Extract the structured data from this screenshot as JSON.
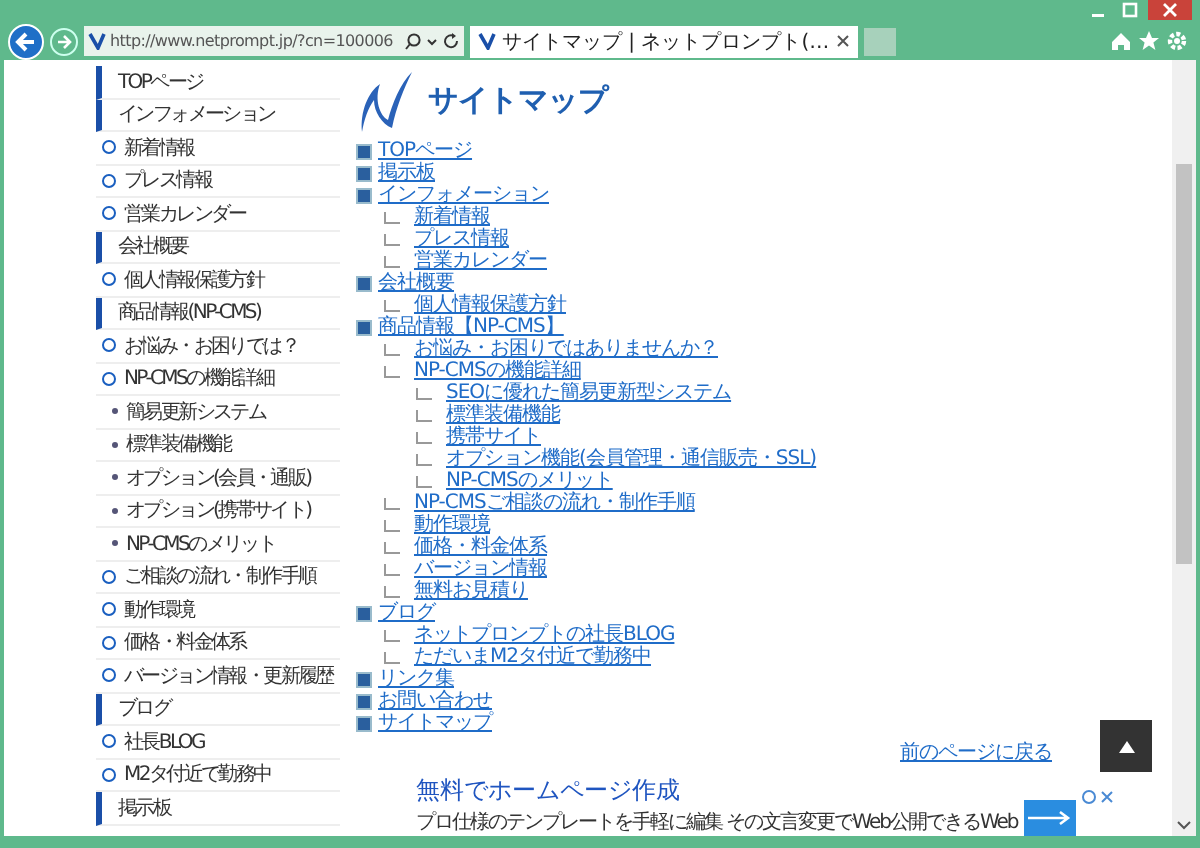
{
  "browser": {
    "address": "http://www.netprompt.jp/?cn=100006",
    "tab_title": "サイトマップ | ネットプロンプト(…"
  },
  "sidebar": {
    "items": [
      {
        "label": "TOPページ",
        "kind": "header"
      },
      {
        "label": "インフォメーション",
        "kind": "header"
      },
      {
        "label": "新着情報",
        "kind": "circle"
      },
      {
        "label": "プレス情報",
        "kind": "circle"
      },
      {
        "label": "営業カレンダー",
        "kind": "circle"
      },
      {
        "label": "会社概要",
        "kind": "header"
      },
      {
        "label": "個人情報保護方針",
        "kind": "circle"
      },
      {
        "label": "商品情報(NP-CMS)",
        "kind": "header"
      },
      {
        "label": "お悩み・お困りでは？",
        "kind": "circle"
      },
      {
        "label": "NP-CMSの機能詳細",
        "kind": "circle"
      },
      {
        "label": "簡易更新システム",
        "kind": "dot"
      },
      {
        "label": "標準装備機能",
        "kind": "dot"
      },
      {
        "label": "オプション(会員・通販)",
        "kind": "dot"
      },
      {
        "label": "オプション(携帯サイト)",
        "kind": "dot"
      },
      {
        "label": "NP-CMSのメリット",
        "kind": "dot"
      },
      {
        "label": "ご相談の流れ・制作手順",
        "kind": "circle"
      },
      {
        "label": "動作環境",
        "kind": "circle"
      },
      {
        "label": "価格・料金体系",
        "kind": "circle"
      },
      {
        "label": "バージョン情報・更新履歴",
        "kind": "circle"
      },
      {
        "label": "ブログ",
        "kind": "header"
      },
      {
        "label": "社長BLOG",
        "kind": "circle"
      },
      {
        "label": "M2タ付近で勤務中",
        "kind": "circle"
      },
      {
        "label": "掲示板",
        "kind": "header"
      }
    ]
  },
  "page_title": "サイトマップ",
  "sitemap": [
    {
      "label": "TOPページ"
    },
    {
      "label": "掲示板"
    },
    {
      "label": "インフォメーション",
      "children": [
        {
          "label": "新着情報"
        },
        {
          "label": "プレス情報"
        },
        {
          "label": "営業カレンダー"
        }
      ]
    },
    {
      "label": "会社概要",
      "children": [
        {
          "label": "個人情報保護方針"
        }
      ]
    },
    {
      "label": "商品情報【NP-CMS】",
      "children": [
        {
          "label": "お悩み・お困りではありませんか？"
        },
        {
          "label": "NP-CMSの機能詳細",
          "children": [
            {
              "label": "SEOに優れた簡易更新型システム"
            },
            {
              "label": "標準装備機能"
            },
            {
              "label": "携帯サイト"
            },
            {
              "label": "オプション機能(会員管理・通信販売・SSL)"
            },
            {
              "label": "NP-CMSのメリット"
            }
          ]
        },
        {
          "label": "NP-CMSご相談の流れ・制作手順"
        },
        {
          "label": "動作環境"
        },
        {
          "label": "価格・料金体系"
        },
        {
          "label": "バージョン情報"
        },
        {
          "label": "無料お見積り"
        }
      ]
    },
    {
      "label": "ブログ",
      "children": [
        {
          "label": "ネットプロンプトの社長BLOG"
        },
        {
          "label": "ただいまM2タ付近で勤務中"
        }
      ]
    },
    {
      "label": "リンク集"
    },
    {
      "label": "お問い合わせ"
    },
    {
      "label": "サイトマップ"
    }
  ],
  "back_link": "前のページに戻る",
  "ad": {
    "title": "無料でホームページ作成",
    "text": "プロ仕様のテンプレートを手軽に編集 その文言変更でWeb公開できるWeb"
  }
}
